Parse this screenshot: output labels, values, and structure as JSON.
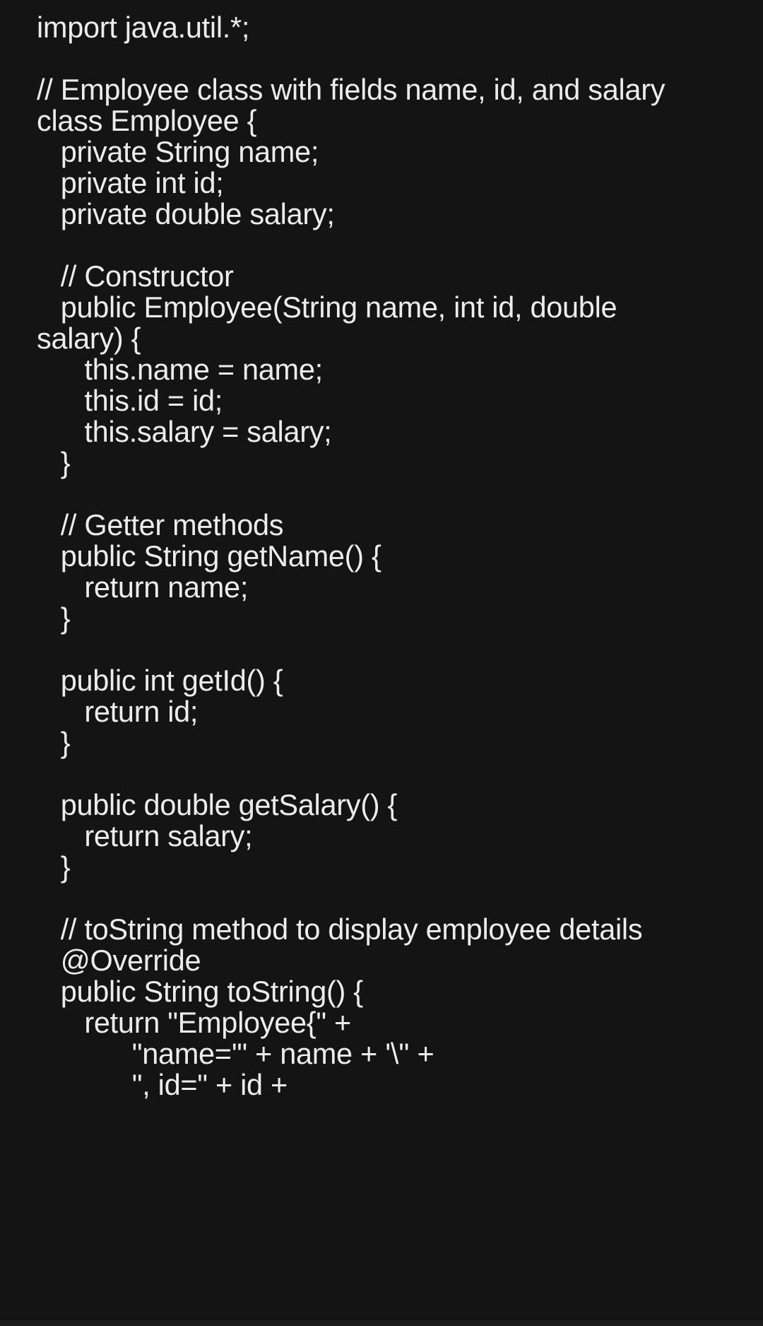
{
  "code": {
    "lines": [
      "import java.util.*;",
      "",
      "// Employee class with fields name, id, and salary",
      "class Employee {",
      "   private String name;",
      "   private int id;",
      "   private double salary;",
      "",
      "   // Constructor",
      "   public Employee(String name, int id, double",
      "salary) {",
      "      this.name = name;",
      "      this.id = id;",
      "      this.salary = salary;",
      "   }",
      "",
      "   // Getter methods",
      "   public String getName() {",
      "      return name;",
      "   }",
      "",
      "   public int getId() {",
      "      return id;",
      "   }",
      "",
      "   public double getSalary() {",
      "      return salary;",
      "   }",
      "",
      "   // toString method to display employee details",
      "   @Override",
      "   public String toString() {",
      "      return \"Employee{\" +",
      "            \"name='\" + name + '\\'' +",
      "            \", id=\" + id +"
    ]
  },
  "colors": {
    "background": "#141414",
    "text": "#ececec"
  }
}
